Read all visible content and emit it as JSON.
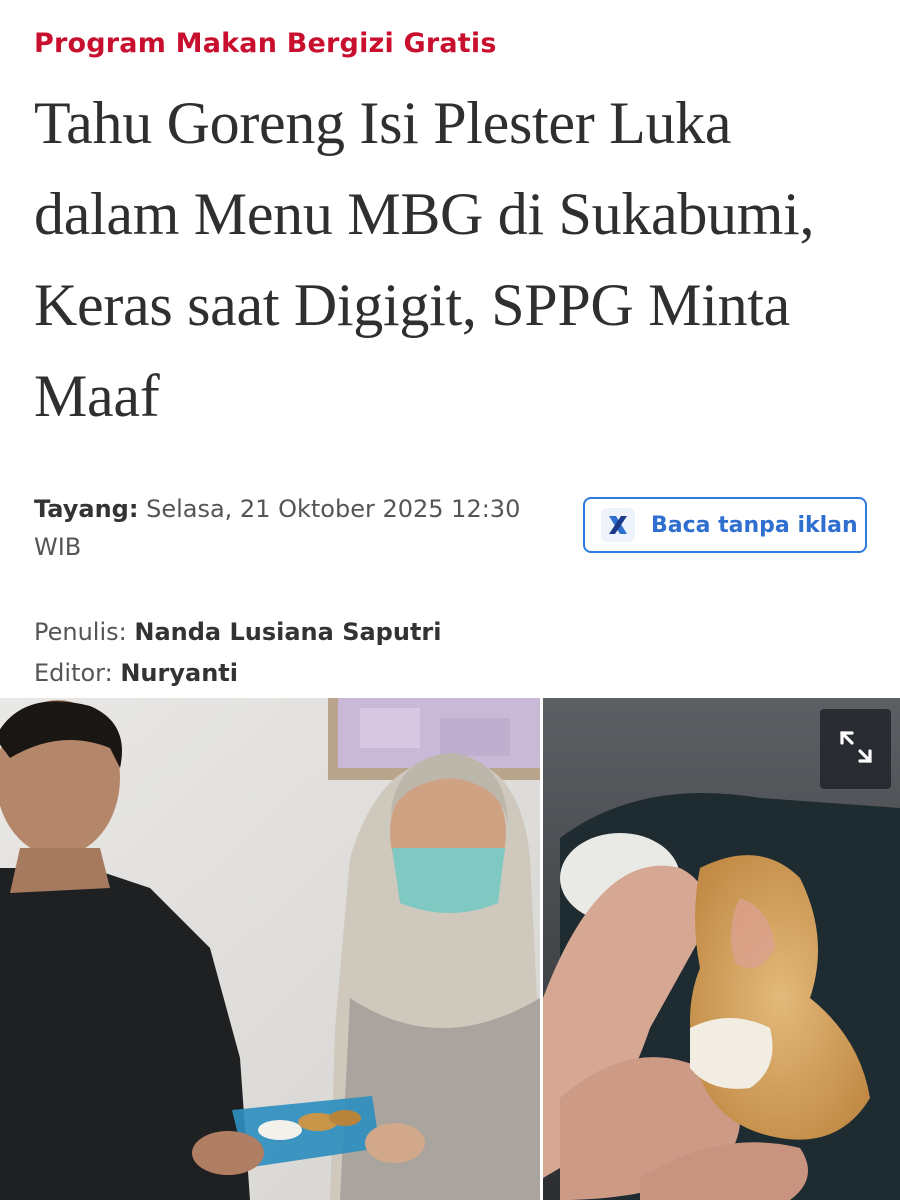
{
  "article": {
    "category": "Program Makan Bergizi Gratis",
    "headline": "Tahu Goreng Isi Plester Luka dalam Menu MBG di Sukabumi, Keras saat Digigit, SPPG Minta Maaf",
    "published_label": "Tayang:",
    "published_value": "Selasa, 21 Oktober 2025 12:30 WIB",
    "writer_label": "Penulis:",
    "writer_name": "Nanda Lusiana Saputri",
    "editor_label": "Editor:",
    "editor_name": "Nuryanti"
  },
  "actions": {
    "ad_free_label": "Baca tanpa iklan",
    "ad_free_icon": "x-logo-icon",
    "expand_icon": "expand-icon"
  },
  "colors": {
    "category": "#c8102e",
    "button_border": "#2f7ae0",
    "button_text": "#2f6fd0"
  }
}
